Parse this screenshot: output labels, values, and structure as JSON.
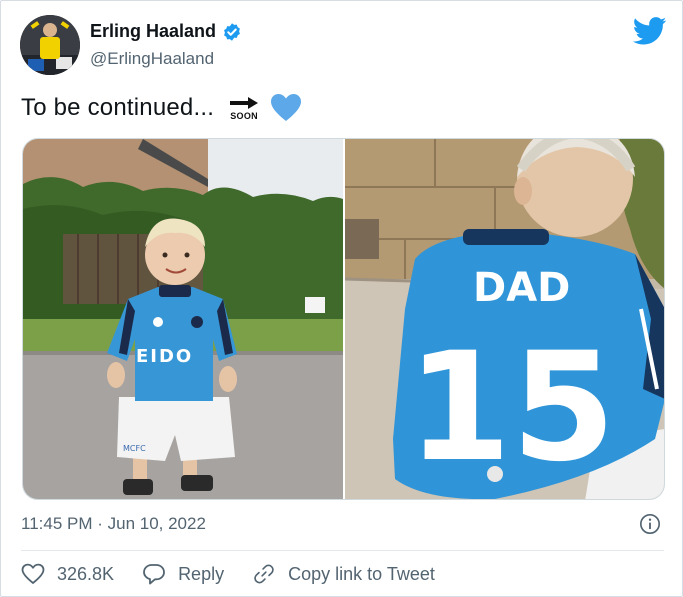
{
  "author": {
    "display_name": "Erling Haaland",
    "handle": "@ErlingHaaland",
    "verified": true,
    "avatar_icon": "profile-photo"
  },
  "tweet": {
    "text": "To be continued...",
    "emoji": [
      {
        "name": "soon-arrow-emoji",
        "label": "SOON"
      },
      {
        "name": "blue-heart-emoji"
      }
    ]
  },
  "media": {
    "photos": [
      {
        "name": "photo-toddler-front",
        "shirt_text": "EIDO",
        "shorts_text": "MCFC"
      },
      {
        "name": "photo-toddler-back",
        "shirt_text": "DAD",
        "shirt_number": "15"
      }
    ]
  },
  "meta": {
    "timestamp": "11:45 PM · Jun 10, 2022"
  },
  "actions": {
    "like_count": "326.8K",
    "reply_label": "Reply",
    "copy_link_label": "Copy link to Tweet"
  },
  "colors": {
    "brand": "#1d9bf0",
    "secondary_text": "#536471",
    "heart": "#5da8e8"
  }
}
